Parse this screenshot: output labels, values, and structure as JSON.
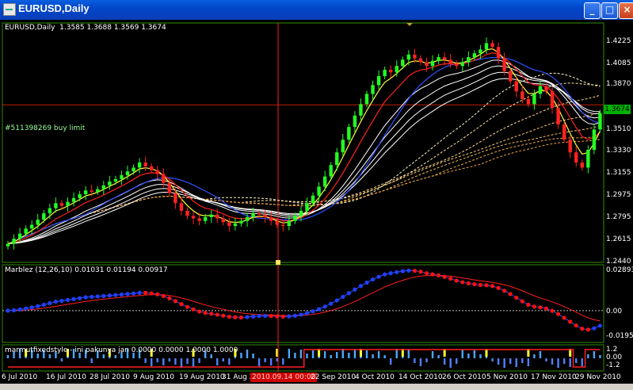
{
  "window": {
    "title": "EURUSD,Daily",
    "buttons": [
      "_",
      "□",
      "×"
    ]
  },
  "chart_data": [
    {
      "type": "candlestick",
      "title": "EURUSD,Daily",
      "ohlc": "1.3585 1.3688 1.3569 1.3674",
      "annotation": "#511398269 buy limit",
      "current_price": "1.3674",
      "yticks": [
        "1.4225",
        "1.4085",
        "1.3870",
        "1.3674",
        "1.3510",
        "1.3330",
        "1.3155",
        "1.2975",
        "1.2795",
        "1.2615",
        "1.2440"
      ],
      "ylim": [
        1.244,
        1.43
      ],
      "xticks": [
        "6 Jul 2010",
        "16 Jul 2010",
        "28 Jul 2010",
        "9 Aug 2010",
        "19 Aug 2010",
        "31 Aug 2010",
        "22 Sep 2010",
        "4 Oct 2010",
        "14 Oct 2010",
        "26 Oct 2010",
        "5 Nov 2010",
        "17 Nov 2010",
        "29 Nov 2010"
      ],
      "crosshair_date": "2010.09.14 00:00",
      "close": [
        1.258,
        1.262,
        1.266,
        1.27,
        1.273,
        1.277,
        1.282,
        1.286,
        1.29,
        1.288,
        1.291,
        1.294,
        1.297,
        1.3,
        1.299,
        1.301,
        1.304,
        1.307,
        1.309,
        1.312,
        1.315,
        1.318,
        1.322,
        1.319,
        1.316,
        1.313,
        1.306,
        1.298,
        1.29,
        1.284,
        1.28,
        1.278,
        1.276,
        1.279,
        1.281,
        1.278,
        1.275,
        1.272,
        1.274,
        1.276,
        1.279,
        1.282,
        1.281,
        1.279,
        1.276,
        1.273,
        1.272,
        1.276,
        1.28,
        1.284,
        1.29,
        1.296,
        1.303,
        1.311,
        1.32,
        1.33,
        1.34,
        1.35,
        1.359,
        1.368,
        1.376,
        1.383,
        1.39,
        1.395,
        1.393,
        1.398,
        1.403,
        1.407,
        1.404,
        1.401,
        1.398,
        1.402,
        1.405,
        1.403,
        1.4,
        1.398,
        1.401,
        1.405,
        1.408,
        1.411,
        1.416,
        1.413,
        1.404,
        1.394,
        1.386,
        1.378,
        1.372,
        1.368,
        1.376,
        1.382,
        1.378,
        1.365,
        1.352,
        1.34,
        1.33,
        1.322,
        1.318,
        1.332,
        1.348,
        1.361
      ],
      "panels": [
        {
          "name": "Marblez (12,26,10) 0.01031 0.01194 0.00917",
          "yticks": [
            "0.02893",
            "0.00",
            "-0.01955"
          ]
        },
        {
          "name": "marmutfixedstyle - ini pakunya jan 0.0000 0.0000 1.0000 1.0000",
          "yticks": [
            "1.2",
            "0.00",
            "-1.2"
          ]
        }
      ]
    }
  ]
}
